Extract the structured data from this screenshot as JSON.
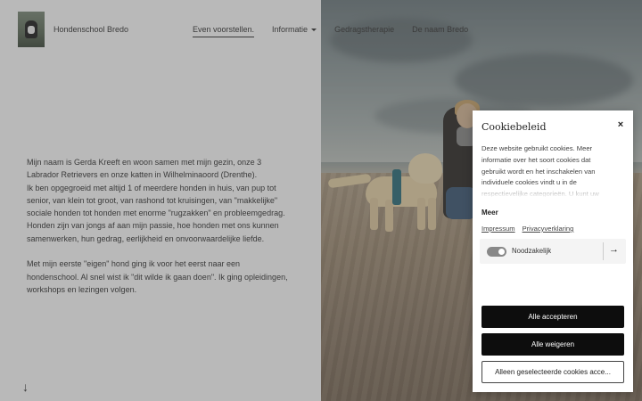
{
  "header": {
    "brand": "Hondenschool Bredo",
    "nav": [
      {
        "label": "Even voorstellen.",
        "active": true
      },
      {
        "label": "Informatie",
        "has_dropdown": true
      },
      {
        "label": "Gedragstherapie"
      },
      {
        "label": "De naam Bredo"
      }
    ]
  },
  "bio": {
    "paragraph1": "Mijn naam is Gerda Kreeft en woon samen met mijn gezin, onze 3\nLabrador Retrievers  en onze katten in Wilhelminaoord (Drenthe).\nIk ben opgegroeid met altijd 1 of meerdere honden in huis, van pup tot\nsenior, van klein tot groot, van rashond tot kruisingen, van \"makkelijke\"\nsociale honden tot honden met enorme \"rugzakken\" en probleemgedrag.\nHonden zijn van jongs af aan mijn passie, hoe honden met ons kunnen\nsamenwerken, hun gedrag, eerlijkheid en onvoorwaardelijke liefde.",
    "paragraph2": "Met mijn eerste \"eigen\" hond ging ik voor het eerst naar een\nhondenschool. Al snel wist ik \"dit wilde ik gaan doen\". Ik ging opleidingen,\nworkshops en lezingen volgen."
  },
  "icons": {
    "scroll_down": "arrow-down-icon",
    "close": "close-icon",
    "row_arrow": "arrow-right-icon"
  },
  "cookie_modal": {
    "title": "Cookiebeleid",
    "close_glyph": "×",
    "description": "Deze website gebruikt cookies. Meer informatie over het soort cookies dat gebruikt wordt en het inschakelen van individuele cookies vindt u in de respectievelijke categorieën. U kunt uw",
    "more_label": "Meer",
    "links": [
      "Impressum",
      "Privacyverklaring"
    ],
    "category": {
      "label": "Noodzakelijk",
      "enabled": true
    },
    "buttons": {
      "accept_all": "Alle accepteren",
      "reject_all": "Alle weigeren",
      "accept_selected": "Alleen geselecteerde cookies acce..."
    }
  },
  "colors": {
    "button_dark": "#0d0d0d",
    "toggle_on": "#888888"
  }
}
